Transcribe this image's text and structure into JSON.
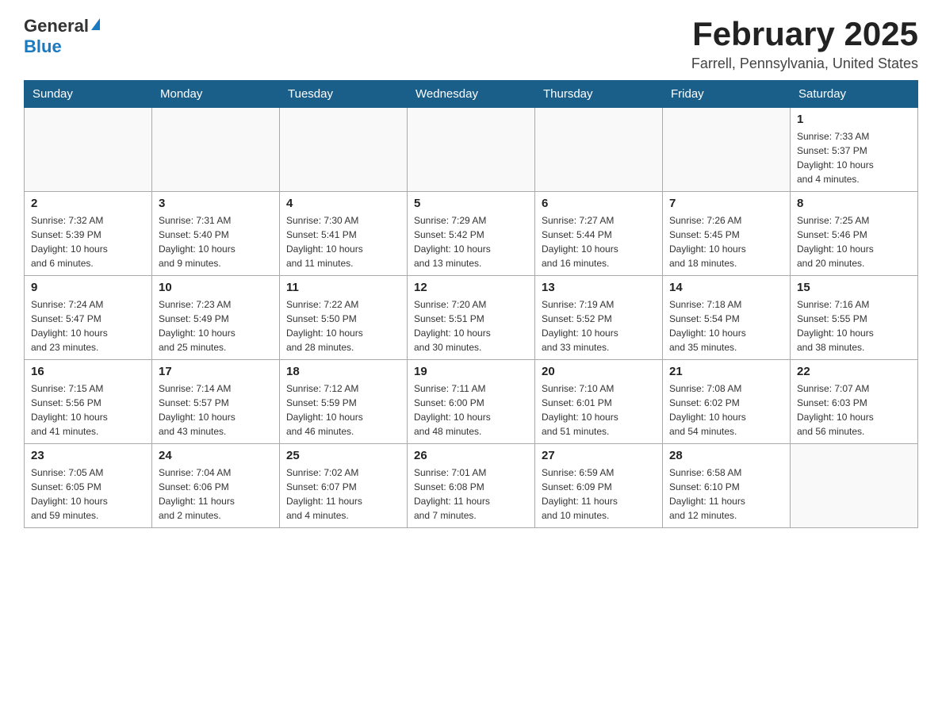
{
  "header": {
    "logo_general": "General",
    "logo_blue": "Blue",
    "title": "February 2025",
    "subtitle": "Farrell, Pennsylvania, United States"
  },
  "days_of_week": [
    "Sunday",
    "Monday",
    "Tuesday",
    "Wednesday",
    "Thursday",
    "Friday",
    "Saturday"
  ],
  "weeks": [
    [
      {
        "day": "",
        "info": ""
      },
      {
        "day": "",
        "info": ""
      },
      {
        "day": "",
        "info": ""
      },
      {
        "day": "",
        "info": ""
      },
      {
        "day": "",
        "info": ""
      },
      {
        "day": "",
        "info": ""
      },
      {
        "day": "1",
        "info": "Sunrise: 7:33 AM\nSunset: 5:37 PM\nDaylight: 10 hours\nand 4 minutes."
      }
    ],
    [
      {
        "day": "2",
        "info": "Sunrise: 7:32 AM\nSunset: 5:39 PM\nDaylight: 10 hours\nand 6 minutes."
      },
      {
        "day": "3",
        "info": "Sunrise: 7:31 AM\nSunset: 5:40 PM\nDaylight: 10 hours\nand 9 minutes."
      },
      {
        "day": "4",
        "info": "Sunrise: 7:30 AM\nSunset: 5:41 PM\nDaylight: 10 hours\nand 11 minutes."
      },
      {
        "day": "5",
        "info": "Sunrise: 7:29 AM\nSunset: 5:42 PM\nDaylight: 10 hours\nand 13 minutes."
      },
      {
        "day": "6",
        "info": "Sunrise: 7:27 AM\nSunset: 5:44 PM\nDaylight: 10 hours\nand 16 minutes."
      },
      {
        "day": "7",
        "info": "Sunrise: 7:26 AM\nSunset: 5:45 PM\nDaylight: 10 hours\nand 18 minutes."
      },
      {
        "day": "8",
        "info": "Sunrise: 7:25 AM\nSunset: 5:46 PM\nDaylight: 10 hours\nand 20 minutes."
      }
    ],
    [
      {
        "day": "9",
        "info": "Sunrise: 7:24 AM\nSunset: 5:47 PM\nDaylight: 10 hours\nand 23 minutes."
      },
      {
        "day": "10",
        "info": "Sunrise: 7:23 AM\nSunset: 5:49 PM\nDaylight: 10 hours\nand 25 minutes."
      },
      {
        "day": "11",
        "info": "Sunrise: 7:22 AM\nSunset: 5:50 PM\nDaylight: 10 hours\nand 28 minutes."
      },
      {
        "day": "12",
        "info": "Sunrise: 7:20 AM\nSunset: 5:51 PM\nDaylight: 10 hours\nand 30 minutes."
      },
      {
        "day": "13",
        "info": "Sunrise: 7:19 AM\nSunset: 5:52 PM\nDaylight: 10 hours\nand 33 minutes."
      },
      {
        "day": "14",
        "info": "Sunrise: 7:18 AM\nSunset: 5:54 PM\nDaylight: 10 hours\nand 35 minutes."
      },
      {
        "day": "15",
        "info": "Sunrise: 7:16 AM\nSunset: 5:55 PM\nDaylight: 10 hours\nand 38 minutes."
      }
    ],
    [
      {
        "day": "16",
        "info": "Sunrise: 7:15 AM\nSunset: 5:56 PM\nDaylight: 10 hours\nand 41 minutes."
      },
      {
        "day": "17",
        "info": "Sunrise: 7:14 AM\nSunset: 5:57 PM\nDaylight: 10 hours\nand 43 minutes."
      },
      {
        "day": "18",
        "info": "Sunrise: 7:12 AM\nSunset: 5:59 PM\nDaylight: 10 hours\nand 46 minutes."
      },
      {
        "day": "19",
        "info": "Sunrise: 7:11 AM\nSunset: 6:00 PM\nDaylight: 10 hours\nand 48 minutes."
      },
      {
        "day": "20",
        "info": "Sunrise: 7:10 AM\nSunset: 6:01 PM\nDaylight: 10 hours\nand 51 minutes."
      },
      {
        "day": "21",
        "info": "Sunrise: 7:08 AM\nSunset: 6:02 PM\nDaylight: 10 hours\nand 54 minutes."
      },
      {
        "day": "22",
        "info": "Sunrise: 7:07 AM\nSunset: 6:03 PM\nDaylight: 10 hours\nand 56 minutes."
      }
    ],
    [
      {
        "day": "23",
        "info": "Sunrise: 7:05 AM\nSunset: 6:05 PM\nDaylight: 10 hours\nand 59 minutes."
      },
      {
        "day": "24",
        "info": "Sunrise: 7:04 AM\nSunset: 6:06 PM\nDaylight: 11 hours\nand 2 minutes."
      },
      {
        "day": "25",
        "info": "Sunrise: 7:02 AM\nSunset: 6:07 PM\nDaylight: 11 hours\nand 4 minutes."
      },
      {
        "day": "26",
        "info": "Sunrise: 7:01 AM\nSunset: 6:08 PM\nDaylight: 11 hours\nand 7 minutes."
      },
      {
        "day": "27",
        "info": "Sunrise: 6:59 AM\nSunset: 6:09 PM\nDaylight: 11 hours\nand 10 minutes."
      },
      {
        "day": "28",
        "info": "Sunrise: 6:58 AM\nSunset: 6:10 PM\nDaylight: 11 hours\nand 12 minutes."
      },
      {
        "day": "",
        "info": ""
      }
    ]
  ]
}
